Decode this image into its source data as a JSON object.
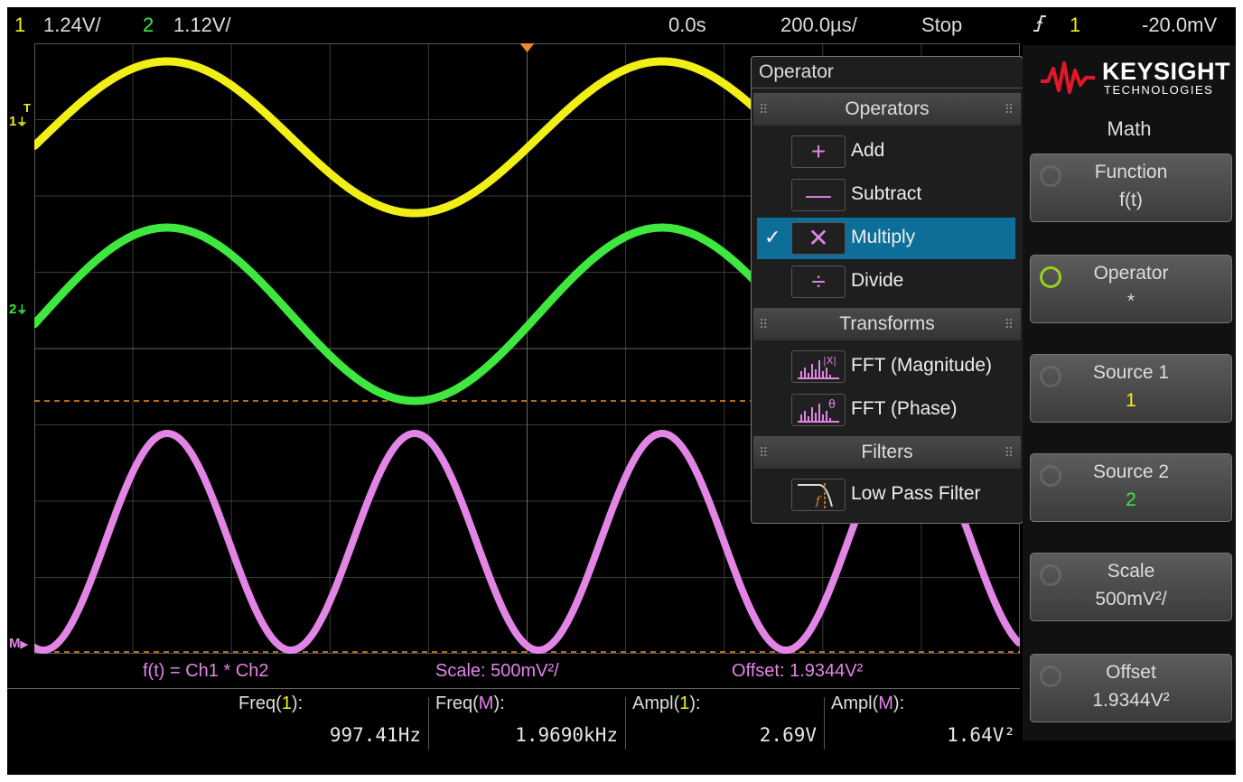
{
  "status_bar": {
    "ch1_num": "1",
    "ch1_scale": "1.24V/",
    "ch2_num": "2",
    "ch2_scale": "1.12V/",
    "time_pos": "0.0s",
    "time_scale": "200.0µs/",
    "run_state": "Stop",
    "trigger_icon": "rising-edge-trigger-icon",
    "trigger_source": "1",
    "trigger_level": "-20.0mV"
  },
  "markers": {
    "ch1": "1",
    "ch1_trig": "T",
    "ch2": "2",
    "math": "M"
  },
  "math_info": {
    "formula": "f(t) = Ch1 * Ch2",
    "scale": "Scale: 500mV²/",
    "offset": "Offset: 1.9344V²"
  },
  "measurements": [
    {
      "pre": "Freq(",
      "src": "1",
      "post": "):",
      "value": "997.41Hz"
    },
    {
      "pre": "Freq(",
      "src": "M",
      "post": "):",
      "value": "1.9690kHz"
    },
    {
      "pre": "Ampl(",
      "src": "1",
      "post": "):",
      "value": "2.69V"
    },
    {
      "pre": "Ampl(",
      "src": "M",
      "post": "):",
      "value": "1.64V²"
    }
  ],
  "popup": {
    "title": "Operator",
    "sections": {
      "operators": "Operators",
      "transforms": "Transforms",
      "filters": "Filters"
    },
    "items": {
      "add": {
        "label": "Add",
        "glyph": "+"
      },
      "subtract": {
        "label": "Subtract",
        "glyph": "—"
      },
      "multiply": {
        "label": "Multiply",
        "glyph": "✕",
        "check": "✓"
      },
      "divide": {
        "label": "Divide",
        "glyph": "÷"
      },
      "fft_mag": {
        "label": "FFT (Magnitude)"
      },
      "fft_phase": {
        "label": "FFT (Phase)"
      },
      "lpf": {
        "label": "Low Pass Filter"
      }
    }
  },
  "side_panel": {
    "brand": "KEYSIGHT",
    "brand_sub": "TECHNOLOGIES",
    "title": "Math",
    "softkeys": {
      "function": {
        "label": "Function",
        "value": "f(t)"
      },
      "operator": {
        "label": "Operator",
        "value": "*"
      },
      "source1": {
        "label": "Source 1",
        "value": "1"
      },
      "source2": {
        "label": "Source 2",
        "value": "2"
      },
      "scale": {
        "label": "Scale",
        "value": "500mV²/"
      },
      "offset": {
        "label": "Offset",
        "value": "1.9344V²"
      }
    }
  },
  "colors": {
    "ch1": "#f2ef16",
    "ch2": "#3ee83e",
    "math": "#e285e6",
    "accent_orange": "#f08a28",
    "selection_blue": "#0d6f98",
    "background": "#000000"
  }
}
